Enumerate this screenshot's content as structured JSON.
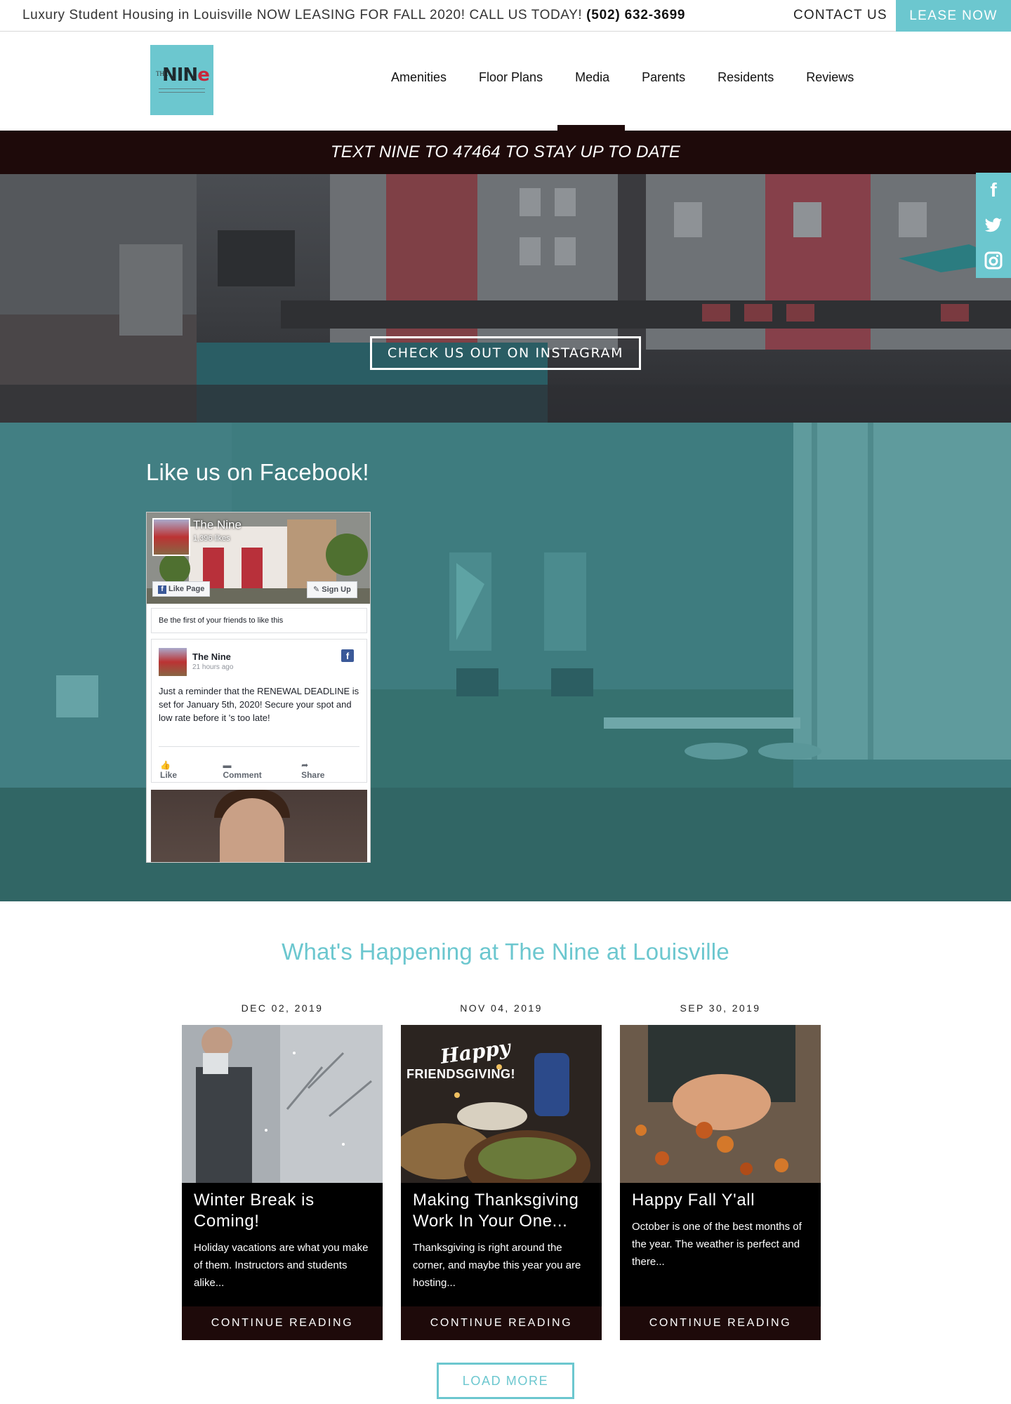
{
  "topbar": {
    "promo_text": "Luxury Student Housing in Louisville NOW LEASING FOR FALL 2020! CALL US TODAY!",
    "phone": "(502) 632-3699",
    "contact_label": "CONTACT US",
    "lease_label": "LEASE NOW"
  },
  "logo": {
    "the": "THE",
    "nine_prefix": "NIN",
    "nine_suffix": "e"
  },
  "nav": {
    "items": [
      "Amenities",
      "Floor Plans",
      "Media",
      "Parents",
      "Residents",
      "Reviews"
    ],
    "active": "Media"
  },
  "text_banner": "TEXT NINE TO 47464 TO STAY UP TO DATE",
  "hero": {
    "button_label": "CHECK US OUT ON INSTAGRAM"
  },
  "social": {
    "facebook": "f",
    "twitter": "t",
    "instagram": "◎"
  },
  "facebook_section": {
    "heading": "Like us on Facebook!",
    "widget": {
      "page_name": "The Nine",
      "likes": "1,396 likes",
      "like_button": "Like Page",
      "signup_button": "Sign Up",
      "friends_text": "Be the first of your friends to like this",
      "post": {
        "author": "The Nine",
        "time": "21 hours ago",
        "text": "Just a reminder that the RENEWAL DEADLINE is set for January 5th, 2020! Secure your spot and low rate before it 's too late!",
        "like": "Like",
        "comment": "Comment",
        "share": "Share"
      }
    }
  },
  "blog": {
    "title": "What's Happening at The Nine at Louisville",
    "posts": [
      {
        "date": "DEC 02, 2019",
        "title": "Winter Break is Coming!",
        "excerpt": "Holiday vacations are what you make of them. Instructors and students alike...",
        "cta": "CONTINUE READING"
      },
      {
        "date": "NOV 04, 2019",
        "title": "Making Thanksgiving Work In Your One...",
        "excerpt": "Thanksgiving is right around the corner, and maybe this year you are hosting...",
        "cta": "CONTINUE READING",
        "image_text_1": "Happy",
        "image_text_2": "FRIENDSGIVING!"
      },
      {
        "date": "SEP 30, 2019",
        "title": "Happy Fall Y'all",
        "excerpt": "October is one of the best months of the year. The weather is perfect and there...",
        "cta": "CONTINUE READING"
      }
    ],
    "load_more": "LOAD MORE"
  },
  "colors": {
    "accent": "#6cc7cf",
    "dark_band": "#1e0a0a",
    "facebook_blue": "#3b5998"
  }
}
